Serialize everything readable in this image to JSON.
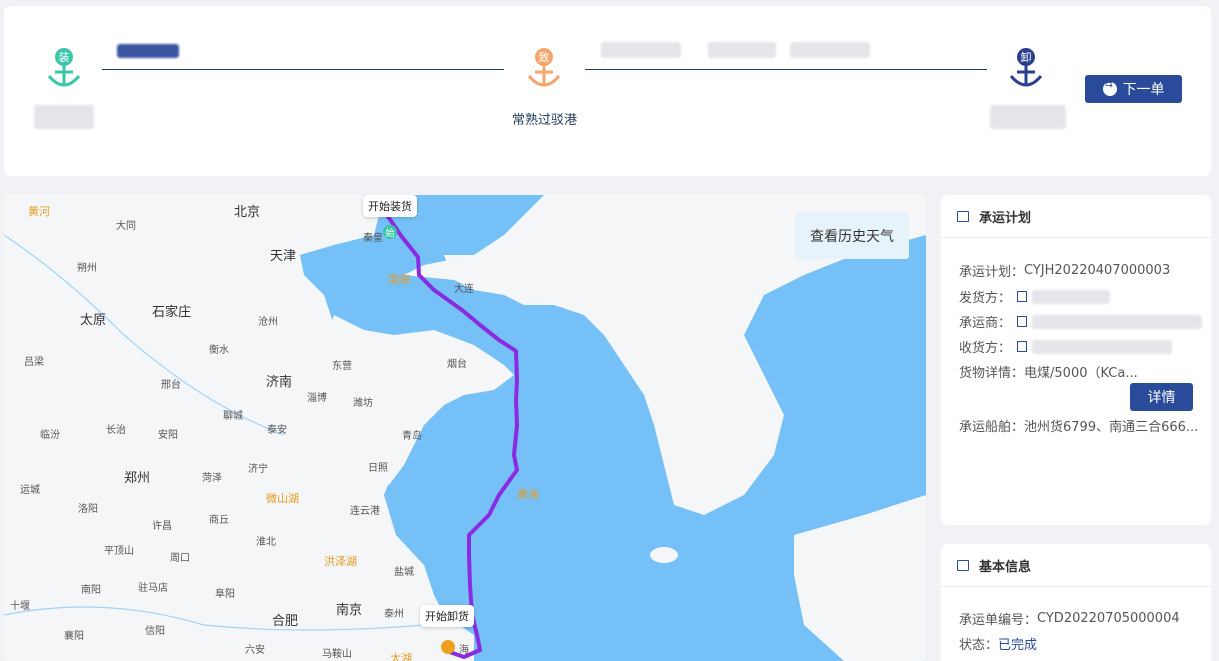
{
  "route": {
    "load_char": "装",
    "via_char": "致",
    "unload_char": "卸",
    "via_port_label": "常熟过驳港",
    "next_button": "下一单",
    "colors": {
      "load": "#3cc6a8",
      "via": "#f5a56b",
      "unload": "#2a3f8f",
      "line": "#1f3a5a",
      "button": "#2a4a9a"
    }
  },
  "map": {
    "weather_button": "查看历史天气",
    "start_tip": "开始装货",
    "end_tip": "开始卸货",
    "start_marker": "始",
    "route_color": "#8a2be2",
    "labels": {
      "huanghe": "黄河",
      "beijing": "北京",
      "datong": "大同",
      "tianjin": "天津",
      "shuozhou": "朔州",
      "taiyuan": "太原",
      "shijiazhuang": "石家庄",
      "cangzhou": "沧州",
      "hengshui": "衡水",
      "lvliang": "吕梁",
      "xingtai": "邢台",
      "jinan": "济南",
      "dongying": "东营",
      "zibo": "淄博",
      "weifang": "潍坊",
      "yantai": "烟台",
      "liaocheng": "聊城",
      "taian": "泰安",
      "linfen": "临汾",
      "changzhi": "长治",
      "anyang": "安阳",
      "qingdao": "青岛",
      "rizhao": "日照",
      "zhengzhou": "郑州",
      "heze": "菏泽",
      "jining": "济宁",
      "weishanhu": "微山湖",
      "yuncheng": "运城",
      "luoyang": "洛阳",
      "xuchang": "许昌",
      "shangqiu": "商丘",
      "lianyungang": "连云港",
      "pingdingshan": "平顶山",
      "zhoukou": "周口",
      "huaibei": "淮北",
      "hongzehu": "洪泽湖",
      "yancheng": "盐城",
      "nanyang": "南阳",
      "zhumadian": "驻马店",
      "fuyang": "阜阳",
      "shiyan": "十堰",
      "xiangyang": "襄阳",
      "xinyang": "信阳",
      "hefei": "合肥",
      "nanjing": "南京",
      "taizhou": "泰州",
      "luan": "六安",
      "maanshan": "马鞍山",
      "bohai": "渤海",
      "dalian": "大连",
      "huanghai": "黄海",
      "qinhuangdao": "秦皇",
      "shanghai": "海",
      "taihu": "太湖"
    }
  },
  "plan": {
    "title": "承运计划",
    "plan_no_label": "承运计划：",
    "plan_no": "CYJH20220407000003",
    "shipper_label": "发货方：",
    "carrier_label": "承运商：",
    "receiver_label": "收货方：",
    "goods_label": "货物详情：",
    "goods": "电煤/5000（KCa...",
    "detail_button": "详情",
    "vessels_label": "承运船舶：",
    "vessels": "池州货6799、南通三合666..."
  },
  "basic": {
    "title": "基本信息",
    "waybill_label": "承运单编号：",
    "waybill": "CYD20220705000004",
    "status_label": "状态：",
    "status": "已完成"
  }
}
